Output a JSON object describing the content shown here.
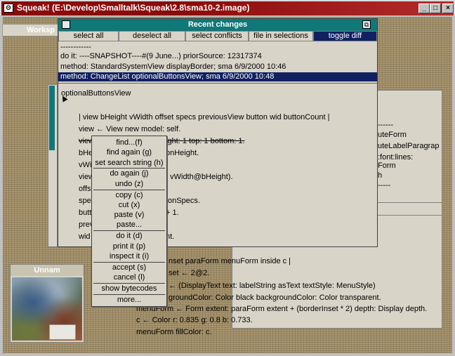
{
  "window": {
    "title": "Squeak! (E:\\Develop\\Smalltalk\\Squeak\\2.8\\sma10-2.image)",
    "app_icon": "squeak-mouse-icon",
    "minimize_glyph": "_",
    "maximize_glyph": "□",
    "close_glyph": "×"
  },
  "workspace_tab": {
    "label": "Worksp"
  },
  "thumbnail_window": {
    "title": "Unnam"
  },
  "background_window": {
    "right_lines": [
      "uteForm",
      "uteLabelParagrap",
      ":font:lines:",
      "Form",
      "h",
      "-----"
    ],
    "top_dashes": "------",
    "code_lines": [
      "nset paraForm menuForm inside c |",
      "set ← 2@2.",
      "← (DisplayText text: labelString asText textStyle: MenuStyle)",
      "groundColor: Color black backgroundColor: Color transparent.",
      "menuForm ← Form extent: paraForm extent + (borderInset * 2) depth: Display depth.",
      "c ← Color r: 0.835 g: 0.8 b: 0.733.",
      "menuForm fillColor: c."
    ]
  },
  "recent_changes": {
    "title": "Recent changes",
    "buttons": [
      "select all",
      "deselect all",
      "select conflicts",
      "file in selections",
      "toggle diff"
    ],
    "list": [
      "------------",
      "do it: ----SNAPSHOT----#(9 June...) priorSource: 12317374",
      "method: StandardSystemView displayBorder; sma 6/9/2000 10:46",
      "method: ChangeList optionalButtonsView; sma 6/9/2000 10:48"
    ],
    "code": {
      "selector": "optionalButtonsView",
      "temps": "| view bHeight vWidth offset specs previousView button wid buttonCount |",
      "line_view_new": "view ← View new model: self.",
      "line_view_prefix": "view",
      "line_view_struck": "ight: 1 top: 1 bottom: 1.",
      "line_bheight_prefix": "bHe",
      "line_bheight_tail": "onHeight.",
      "line_vwidth_prefix": "vWi",
      "line_view2_prefix": "view",
      "line_view2_tail": ": vWidth@bHeight).",
      "line_offs_prefix": "offs",
      "line_spec_prefix": "spec",
      "line_spec_tail": "tonSpecs.",
      "line_butt_prefix": "butt",
      "line_butt_tail": "+ 1.",
      "line_prev_prefix": "prev",
      "line_wid_prefix": "wid",
      "line_wid_tail": "nt."
    }
  },
  "context_menu": {
    "groups": [
      [
        "find...(f)",
        "find again (g)",
        "set search string (h)"
      ],
      [
        "do again (j)",
        "undo (z)"
      ],
      [
        "copy (c)",
        "cut (x)",
        "paste (v)",
        "paste..."
      ],
      [
        "do it (d)",
        "print it (p)",
        "inspect it (i)"
      ],
      [
        "accept (s)",
        "cancel (l)"
      ],
      [
        "show bytecodes"
      ],
      [
        "more..."
      ]
    ]
  }
}
